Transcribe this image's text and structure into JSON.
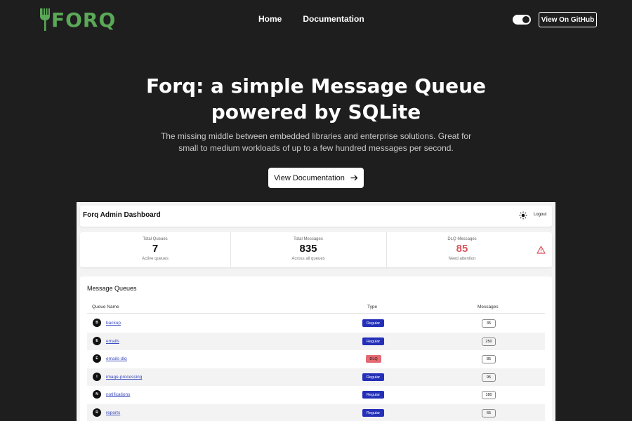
{
  "nav": {
    "logo_text": "FORQ",
    "links": [
      "Home",
      "Documentation"
    ],
    "github_label": "View On GitHub"
  },
  "hero": {
    "title_line1": "Forq: a simple Message Queue",
    "title_line2": "powered by SQLite",
    "subtitle": "The missing middle between embedded libraries and enterprise solutions. Great for small to medium workloads of up to a few hundred messages per second.",
    "cta_label": "View Documentation"
  },
  "dashboard": {
    "title": "Forq Admin Dashboard",
    "logout_label": "Logout",
    "stats": [
      {
        "label": "Total Queues",
        "value": "7",
        "sub": "Active queues"
      },
      {
        "label": "Total Messages",
        "value": "835",
        "sub": "Across all queues"
      },
      {
        "label": "DLQ Messages",
        "value": "85",
        "sub": "Need attention"
      }
    ],
    "queues": {
      "title": "Message Queues",
      "columns": [
        "Queue Name",
        "Type",
        "Messages"
      ],
      "rows": [
        {
          "initial": "B",
          "name": "backup",
          "type": "Regular",
          "messages": "35"
        },
        {
          "initial": "E",
          "name": "emails",
          "type": "Regular",
          "messages": "250"
        },
        {
          "initial": "E",
          "name": "emails-dlq",
          "type": "DLQ",
          "messages": "85"
        },
        {
          "initial": "I",
          "name": "image-processing",
          "type": "Regular",
          "messages": "95"
        },
        {
          "initial": "N",
          "name": "notifications",
          "type": "Regular",
          "messages": "180"
        },
        {
          "initial": "R",
          "name": "reports",
          "type": "Regular",
          "messages": "65"
        }
      ]
    }
  },
  "colors": {
    "page_bg": "#1e1e1e",
    "brand_green": "#5aa858",
    "regular_badge": "#2530b8",
    "dlq_badge": "#e36a72",
    "dlq_value": "#d9545e"
  }
}
